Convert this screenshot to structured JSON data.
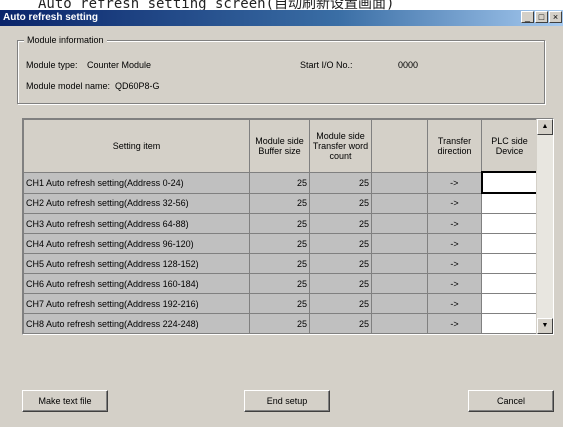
{
  "caption": "Auto refresh setting screen(自动刷新设置画面)",
  "window": {
    "title": "Auto refresh setting",
    "minimize": "_",
    "maximize": "□",
    "close": "×"
  },
  "module_info": {
    "legend": "Module information",
    "type_label": "Module type:",
    "type_value": "Counter Module",
    "start_io_label": "Start I/O No.:",
    "start_io_value": "0000",
    "model_label": "Module model name:",
    "model_value": "QD60P8-G"
  },
  "table": {
    "headers": {
      "setting_item": "Setting item",
      "buffer_size": "Module side Buffer size",
      "word_count": "Module side Transfer word count",
      "blank": "",
      "direction": "Transfer direction",
      "plc_device": "PLC side Device"
    },
    "rows": [
      {
        "item": "CH1 Auto refresh setting(Address 0-24)",
        "buffer": "25",
        "count": "25",
        "dir": "->",
        "device": ""
      },
      {
        "item": "CH2 Auto refresh setting(Address 32-56)",
        "buffer": "25",
        "count": "25",
        "dir": "->",
        "device": ""
      },
      {
        "item": "CH3 Auto refresh setting(Address 64-88)",
        "buffer": "25",
        "count": "25",
        "dir": "->",
        "device": ""
      },
      {
        "item": "CH4 Auto refresh setting(Address 96-120)",
        "buffer": "25",
        "count": "25",
        "dir": "->",
        "device": ""
      },
      {
        "item": "CH5 Auto refresh setting(Address 128-152)",
        "buffer": "25",
        "count": "25",
        "dir": "->",
        "device": ""
      },
      {
        "item": "CH6 Auto refresh setting(Address 160-184)",
        "buffer": "25",
        "count": "25",
        "dir": "->",
        "device": ""
      },
      {
        "item": "CH7 Auto refresh setting(Address 192-216)",
        "buffer": "25",
        "count": "25",
        "dir": "->",
        "device": ""
      },
      {
        "item": "CH8 Auto refresh setting(Address 224-248)",
        "buffer": "25",
        "count": "25",
        "dir": "->",
        "device": ""
      }
    ]
  },
  "buttons": {
    "make_text_file": "Make text file",
    "end_setup": "End setup",
    "cancel": "Cancel"
  },
  "icons": {
    "scroll_up": "▲",
    "scroll_down": "▼"
  }
}
